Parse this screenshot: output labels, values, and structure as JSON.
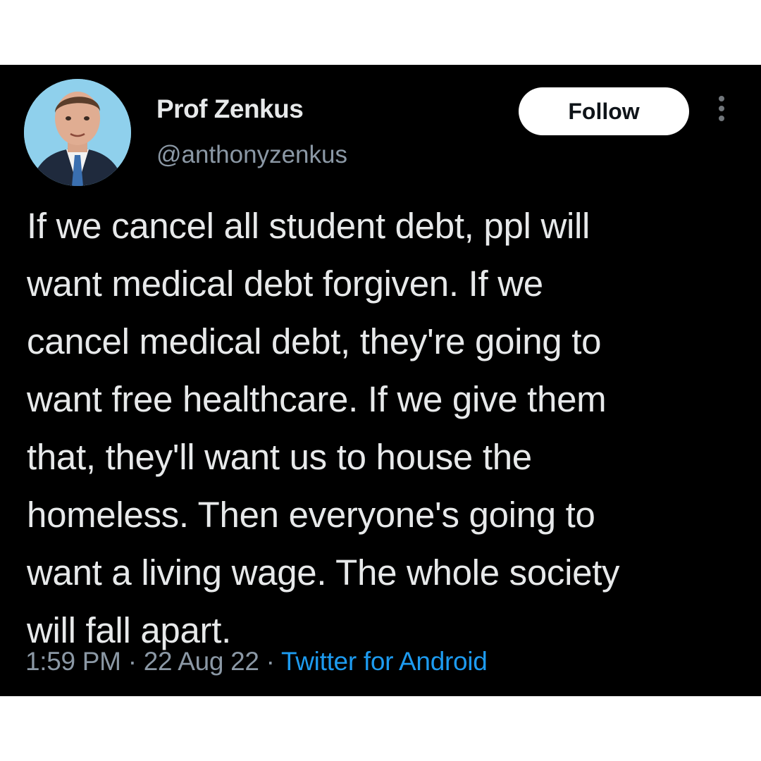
{
  "user": {
    "display_name": "Prof Zenkus",
    "handle": "@anthonyzenkus",
    "follow_label": "Follow"
  },
  "tweet": {
    "lines": [
      "If we cancel all student debt, ppl will",
      "want medical debt forgiven. If we",
      "cancel medical debt, they're going to",
      "want free healthcare. If we give them",
      "that, they'll want us to house the",
      "homeless. Then everyone's going to",
      "want a living wage. The whole society",
      "will fall apart."
    ],
    "time": "1:59 PM",
    "separator": "·",
    "date": "22 Aug 22",
    "source": "Twitter for Android"
  },
  "colors": {
    "background": "#000000",
    "text": "#e7e9ea",
    "muted": "#8b98a5",
    "link": "#1d9bf0",
    "follow_button_bg": "#ffffff"
  },
  "icons": {
    "more": "more-vertical-icon",
    "avatar": "profile-photo"
  }
}
